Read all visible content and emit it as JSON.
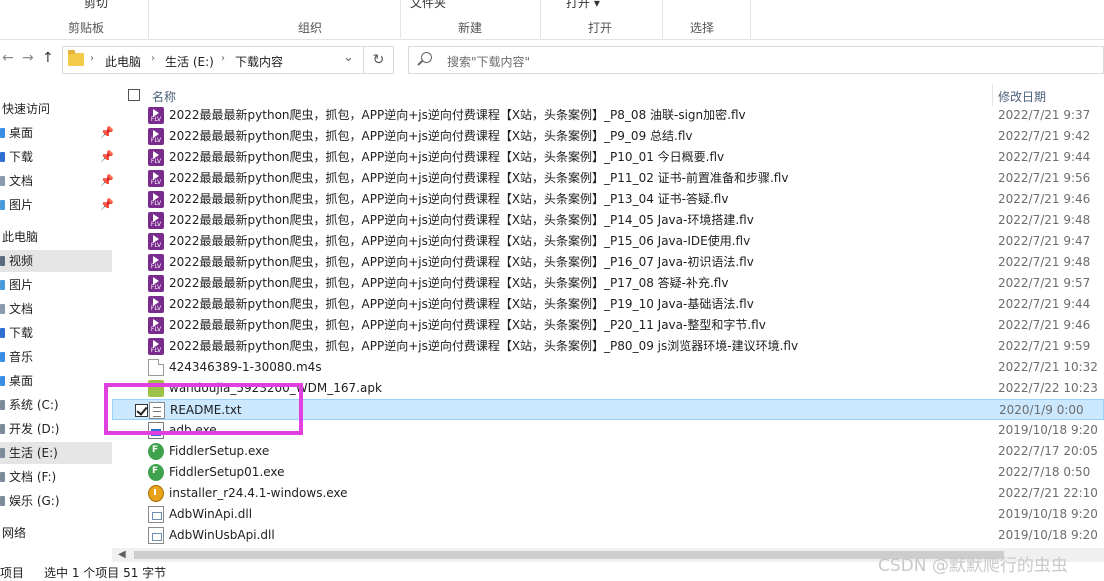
{
  "ribbon": {
    "cut_label": "剪切",
    "clipboard_label": "剪贴板",
    "organize_label": "组织",
    "new_folder_label": "文件夹",
    "new_label": "新建",
    "open_top_label": "打开 ▾",
    "open_label": "打开",
    "select_label": "选择"
  },
  "address": {
    "back_icon": "←",
    "forward_icon": "→",
    "up_icon": "↑",
    "crumbs": [
      "此电脑",
      "生活 (E:)",
      "下载内容"
    ],
    "dropdown_icon": "⌄",
    "refresh_icon": "↻",
    "search_placeholder": "搜索\"下载内容\""
  },
  "nav": {
    "quick_access": "快速访问",
    "quick_items": [
      "桌面",
      "下载",
      "文档",
      "图片"
    ],
    "this_pc": "此电脑",
    "pc_items": [
      "视频",
      "图片",
      "文档",
      "下载",
      "音乐",
      "桌面",
      "系统 (C:)",
      "开发 (D:)",
      "生活 (E:)",
      "文档 (F:)",
      "娱乐 (G:)"
    ],
    "network": "网络"
  },
  "columns": {
    "name": "名称",
    "date": "修改日期"
  },
  "files": [
    {
      "name": "2022最最最新python爬虫，抓包，APP逆向+js逆向付费课程【X站，头条案例】_P8_08 油联-sign加密.flv",
      "date": "2022/7/21 9:37",
      "icon": "flv"
    },
    {
      "name": "2022最最最新python爬虫，抓包，APP逆向+js逆向付费课程【X站，头条案例】_P9_09 总结.flv",
      "date": "2022/7/21 9:42",
      "icon": "flv"
    },
    {
      "name": "2022最最最新python爬虫，抓包，APP逆向+js逆向付费课程【X站，头条案例】_P10_01 今日概要.flv",
      "date": "2022/7/21 9:44",
      "icon": "flv"
    },
    {
      "name": "2022最最最新python爬虫，抓包，APP逆向+js逆向付费课程【X站，头条案例】_P11_02 证书-前置准备和步骤.flv",
      "date": "2022/7/21 9:56",
      "icon": "flv"
    },
    {
      "name": "2022最最最新python爬虫，抓包，APP逆向+js逆向付费课程【X站，头条案例】_P13_04 证书-答疑.flv",
      "date": "2022/7/21 9:46",
      "icon": "flv"
    },
    {
      "name": "2022最最最新python爬虫，抓包，APP逆向+js逆向付费课程【X站，头条案例】_P14_05 Java-环境搭建.flv",
      "date": "2022/7/21 9:48",
      "icon": "flv"
    },
    {
      "name": "2022最最最新python爬虫，抓包，APP逆向+js逆向付费课程【X站，头条案例】_P15_06 Java-IDE使用.flv",
      "date": "2022/7/21 9:47",
      "icon": "flv"
    },
    {
      "name": "2022最最最新python爬虫，抓包，APP逆向+js逆向付费课程【X站，头条案例】_P16_07 Java-初识语法.flv",
      "date": "2022/7/21 9:48",
      "icon": "flv"
    },
    {
      "name": "2022最最最新python爬虫，抓包，APP逆向+js逆向付费课程【X站，头条案例】_P17_08 答疑-补充.flv",
      "date": "2022/7/21 9:57",
      "icon": "flv"
    },
    {
      "name": "2022最最最新python爬虫，抓包，APP逆向+js逆向付费课程【X站，头条案例】_P19_10 Java-基础语法.flv",
      "date": "2022/7/21 9:44",
      "icon": "flv"
    },
    {
      "name": "2022最最最新python爬虫，抓包，APP逆向+js逆向付费课程【X站，头条案例】_P20_11 Java-整型和字节.flv",
      "date": "2022/7/21 9:46",
      "icon": "flv"
    },
    {
      "name": "2022最最最新python爬虫，抓包，APP逆向+js逆向付费课程【X站，头条案例】_P80_09 js浏览器环境-建议环境.flv",
      "date": "2022/7/21 9:59",
      "icon": "flv"
    },
    {
      "name": "424346389-1-30080.m4s",
      "date": "2022/7/21 10:32",
      "icon": "doc"
    },
    {
      "name": "wandoujia_5923200_WDM_167.apk",
      "date": "2022/7/22 10:23",
      "icon": "apk"
    },
    {
      "name": "README.txt",
      "date": "2020/1/9 0:00",
      "icon": "txt",
      "selected": true
    },
    {
      "name": "adb.exe",
      "date": "2019/10/18 9:20",
      "icon": "exe"
    },
    {
      "name": "FiddlerSetup.exe",
      "date": "2022/7/17 20:05",
      "icon": "fid"
    },
    {
      "name": "FiddlerSetup01.exe",
      "date": "2022/7/18 0:50",
      "icon": "fid"
    },
    {
      "name": "installer_r24.4.1-windows.exe",
      "date": "2022/7/21 22:10",
      "icon": "inst"
    },
    {
      "name": "AdbWinApi.dll",
      "date": "2019/10/18 9:20",
      "icon": "dll"
    },
    {
      "name": "AdbWinUsbApi.dll",
      "date": "2019/10/18 9:20",
      "icon": "dll"
    }
  ],
  "status": {
    "item_count": "项目",
    "selection": "选中 1 个项目  51 字节"
  },
  "watermark": "CSDN @默默爬行的虫虫",
  "colors": {
    "selection_bg": "#cce8ff",
    "selection_border": "#99d1ff",
    "highlight": "#e040e0",
    "flv_icon": "#7a2b8e"
  }
}
